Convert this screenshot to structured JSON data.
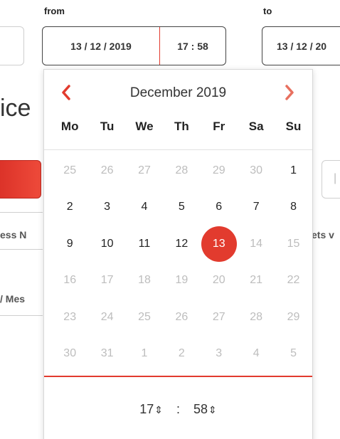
{
  "fields": {
    "from_label": "from",
    "to_label": "to",
    "from_date": "13 / 12 / 2019",
    "from_time": "17 : 58",
    "to_date": "13 / 12 / 20"
  },
  "background": {
    "heading_fragment": "ice",
    "fragment_1": "ess N",
    "fragment_2": "ets v",
    "fragment_3": "/ Mes"
  },
  "calendar": {
    "month_label": "December 2019",
    "weekdays": [
      "Mo",
      "Tu",
      "We",
      "Th",
      "Fr",
      "Sa",
      "Su"
    ],
    "weeks": [
      [
        {
          "d": "25",
          "m": true
        },
        {
          "d": "26",
          "m": true
        },
        {
          "d": "27",
          "m": true
        },
        {
          "d": "28",
          "m": true
        },
        {
          "d": "29",
          "m": true
        },
        {
          "d": "30",
          "m": true
        },
        {
          "d": "1",
          "m": false
        }
      ],
      [
        {
          "d": "2",
          "m": false
        },
        {
          "d": "3",
          "m": false
        },
        {
          "d": "4",
          "m": false
        },
        {
          "d": "5",
          "m": false
        },
        {
          "d": "6",
          "m": false
        },
        {
          "d": "7",
          "m": false
        },
        {
          "d": "8",
          "m": false
        }
      ],
      [
        {
          "d": "9",
          "m": false
        },
        {
          "d": "10",
          "m": false
        },
        {
          "d": "11",
          "m": false
        },
        {
          "d": "12",
          "m": false
        },
        {
          "d": "13",
          "m": false,
          "selected": true
        },
        {
          "d": "14",
          "m": true
        },
        {
          "d": "15",
          "m": true
        }
      ],
      [
        {
          "d": "16",
          "m": true
        },
        {
          "d": "17",
          "m": true
        },
        {
          "d": "18",
          "m": true
        },
        {
          "d": "19",
          "m": true
        },
        {
          "d": "20",
          "m": true
        },
        {
          "d": "21",
          "m": true
        },
        {
          "d": "22",
          "m": true
        }
      ],
      [
        {
          "d": "23",
          "m": true
        },
        {
          "d": "24",
          "m": true
        },
        {
          "d": "25",
          "m": true
        },
        {
          "d": "26",
          "m": true
        },
        {
          "d": "27",
          "m": true
        },
        {
          "d": "28",
          "m": true
        },
        {
          "d": "29",
          "m": true
        }
      ],
      [
        {
          "d": "30",
          "m": true
        },
        {
          "d": "31",
          "m": true
        },
        {
          "d": "1",
          "m": true
        },
        {
          "d": "2",
          "m": true
        },
        {
          "d": "3",
          "m": true
        },
        {
          "d": "4",
          "m": true
        },
        {
          "d": "5",
          "m": true
        }
      ]
    ],
    "hour": "17",
    "minute": "58",
    "separator": ":"
  },
  "colors": {
    "accent": "#e23b2e",
    "muted_day": "#bdbdbd"
  },
  "icons": {
    "prev": "chevron-left-icon",
    "next": "chevron-right-icon",
    "stepper": "up-down-arrows-icon"
  }
}
